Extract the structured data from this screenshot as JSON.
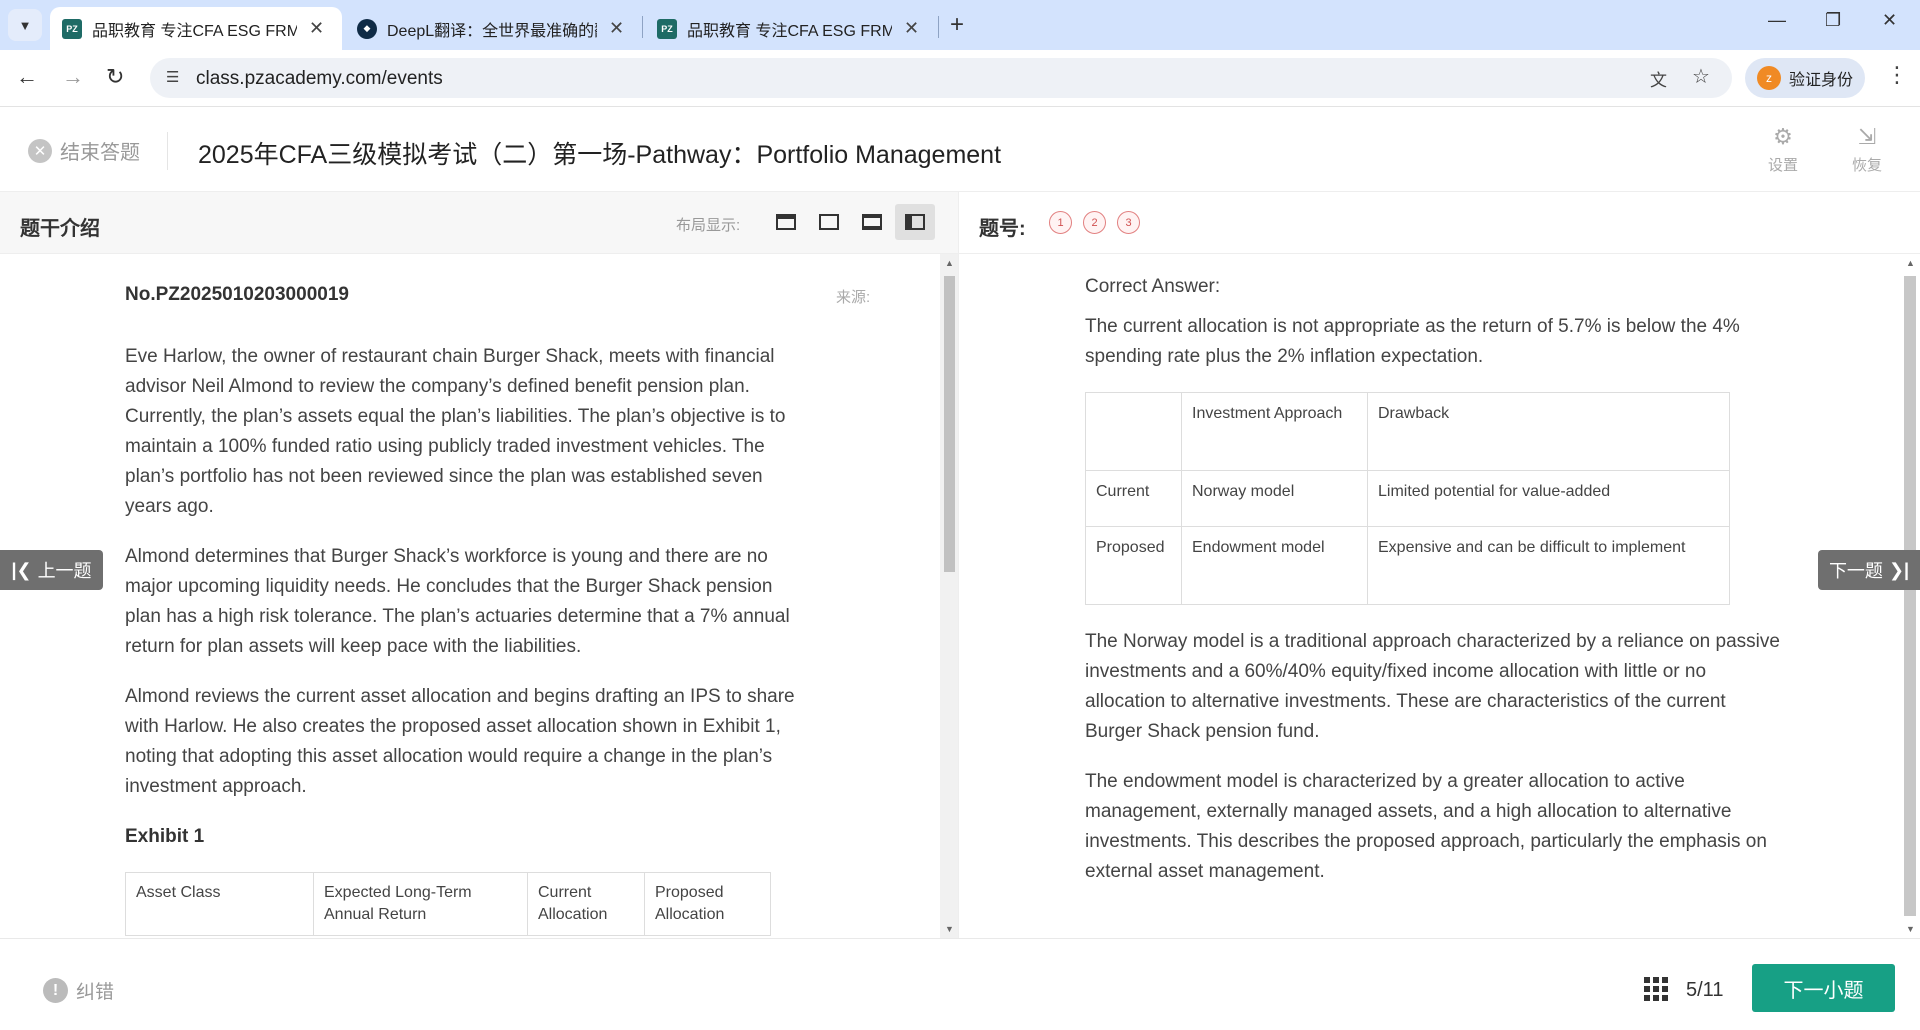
{
  "browser": {
    "tabs": [
      {
        "title": "品职教育 专注CFA ESG FRM CPA",
        "active": true,
        "favicon": "PZ"
      },
      {
        "title": "DeepL翻译：全世界最准确的翻译",
        "active": false,
        "favicon": "deepl-icon"
      },
      {
        "title": "品职教育 专注CFA ESG FRM CPA",
        "active": false,
        "favicon": "PZ"
      }
    ],
    "url": "class.pzacademy.com/events",
    "profile_label": "验证身份"
  },
  "header": {
    "end_label": "结束答题",
    "title": "2025年CFA三级模拟考试（二）第一场-Pathway：Portfolio Management",
    "settings_label": "设置",
    "restore_label": "恢复"
  },
  "left_panel": {
    "heading": "题干介绍",
    "layout_label": "布局显示:",
    "question_id": "No.PZ2025010203000019",
    "source_label": "来源:",
    "paragraphs": [
      "Eve Harlow, the owner of restaurant chain Burger Shack, meets with financial advisor Neil Almond to review the company’s defined benefit pension plan. Currently, the plan’s assets equal the plan’s liabilities. The plan’s objective is to maintain a 100% funded ratio using publicly traded investment vehicles. The plan’s portfolio has not been reviewed since the plan was established seven years ago.",
      "Almond determines that Burger Shack’s workforce is young and there are no major upcoming liquidity needs. He concludes that the Burger Shack pension plan has a high risk tolerance. The plan’s actuaries determine that a 7% annual return for plan assets will keep pace with the liabilities.",
      "Almond reviews the current asset allocation and begins drafting an IPS to share with Harlow. He also creates the proposed asset allocation shown in Exhibit 1, noting that adopting this asset allocation would require a change in the plan’s investment approach."
    ],
    "exhibit_title": "Exhibit 1",
    "exhibit_headers": [
      "Asset Class",
      "Expected Long-Term Annual Return",
      "Current Allocation",
      "Proposed Allocation"
    ]
  },
  "right_panel": {
    "heading": "题号:",
    "question_numbers": [
      "1",
      "2",
      "3"
    ],
    "correct_answer_label": "Correct Answer:",
    "intro": "The current allocation is not appropriate as the return of 5.7% is below the 4% spending rate plus the 2% inflation expectation.",
    "table": [
      [
        "",
        "Investment Approach",
        "Drawback"
      ],
      [
        "Current",
        "Norway model",
        "Limited potential for value-added"
      ],
      [
        "Proposed",
        "Endowment model",
        "Expensive and can be difficult to implement"
      ]
    ],
    "paragraphs": [
      "The Norway model is a traditional approach characterized by a reliance on passive investments and a 60%/40% equity/fixed income allocation with little or no allocation to alternative investments. These are characteristics of the current Burger Shack pension fund.",
      "The endowment model is characterized by a greater allocation to active management, externally managed assets, and a high allocation to alternative investments. This describes the proposed approach, particularly the emphasis on external asset management."
    ]
  },
  "nav": {
    "prev_label": "上一题",
    "next_label": "下一题"
  },
  "footer": {
    "report_label": "纠错",
    "progress": "5/11",
    "next_sub_label": "下一小题"
  },
  "colors": {
    "accent": "#17a085",
    "tabstrip": "#d3e3fd",
    "question_marker": "#d05050"
  }
}
